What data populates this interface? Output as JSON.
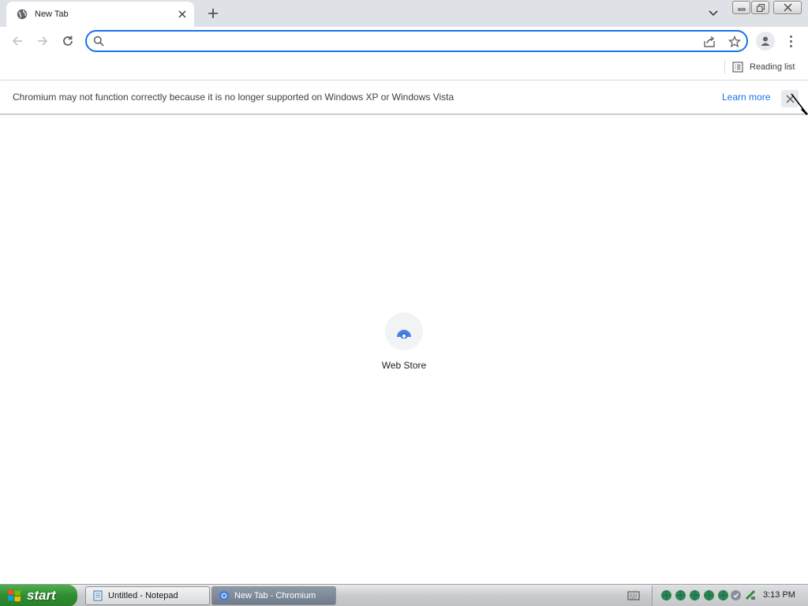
{
  "window": {
    "tab_title": "New Tab"
  },
  "toolbar": {
    "omnibox_value": "",
    "omnibox_placeholder": ""
  },
  "bookmarks": {
    "reading_list_label": "Reading list"
  },
  "infobar": {
    "message": "Chromium may not function correctly because it is no longer supported on Windows XP or Windows Vista",
    "learn_more_label": "Learn more"
  },
  "content": {
    "shortcuts": [
      {
        "label": "Web Store",
        "icon": "web-store-icon"
      }
    ]
  },
  "taskbar": {
    "start_label": "start",
    "tasks": [
      {
        "label": "Untitled - Notepad",
        "icon": "notepad-icon",
        "active": false
      },
      {
        "label": "New Tab - Chromium",
        "icon": "chromium-icon",
        "active": true
      }
    ],
    "clock": "3:13 PM"
  },
  "colors": {
    "accent": "#1a73e8",
    "tabstrip": "#dee1e6",
    "start_green": "#2f8d2f"
  }
}
